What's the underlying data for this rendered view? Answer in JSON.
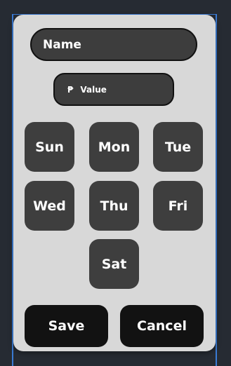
{
  "form": {
    "name_placeholder": "Name",
    "value_currency_symbol": "₱",
    "value_placeholder": "Value"
  },
  "days": [
    "Sun",
    "Mon",
    "Tue",
    "Wed",
    "Thu",
    "Fri",
    "Sat"
  ],
  "actions": {
    "save_label": "Save",
    "cancel_label": "Cancel"
  },
  "colors": {
    "background": "#262b33",
    "card": "#d8d8d8",
    "day_button": "#3e3e3e",
    "action_button": "#121212",
    "window_edge": "#3a7bd5"
  }
}
